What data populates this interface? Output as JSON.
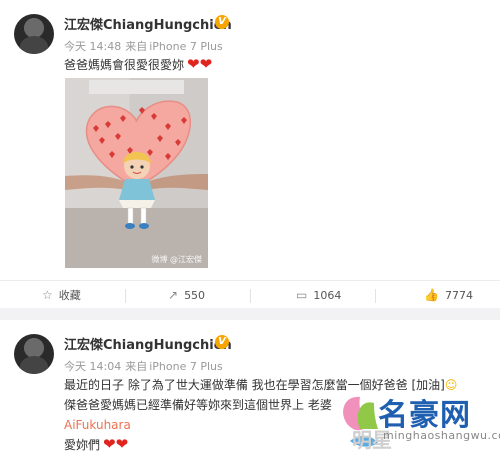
{
  "post1": {
    "username": "江宏傑ChiangHungchieh",
    "time": "今天 14:48",
    "source_prefix": "来自",
    "device": "iPhone 7 Plus",
    "text": "爸爸媽媽會很愛很愛妳",
    "hearts": "❤❤",
    "photo_watermark": "微博 @江宏傑",
    "actions": {
      "favorite_label": "收藏",
      "repost_count": "550",
      "comment_count": "1064",
      "like_count": "7774"
    }
  },
  "post2": {
    "username": "江宏傑ChiangHungchieh",
    "time": "今天 14:04",
    "source_prefix": "来自",
    "device": "iPhone 7 Plus",
    "line1": "最近的日子 除了為了世大運做準備 我也在學習怎麼當一個好爸爸 [加油]",
    "line2": "傑爸爸愛媽媽已經準備好等妳來到這個世界上 老婆",
    "mention": "AiFukuhara",
    "line4": "愛妳們",
    "hearts": "❤❤"
  },
  "watermark": {
    "title": "名豪网",
    "url": "minghaoshangwu.com",
    "gray_text": "明星"
  },
  "colors": {
    "background": "#f2f2f5",
    "badge": "#f7a501",
    "heart": "#e0251f",
    "link": "#eb7350",
    "watermark_blue": "#1f5fb0"
  },
  "icons": [
    "v-badge-icon",
    "favorite-icon",
    "repost-icon",
    "comment-icon",
    "like-icon",
    "heart-icon",
    "smile-emoji-icon"
  ]
}
